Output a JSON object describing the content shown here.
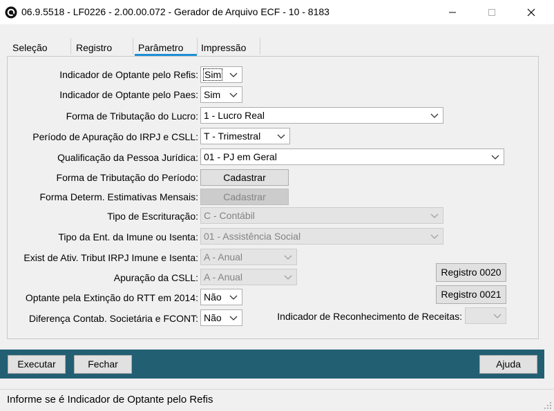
{
  "window": {
    "title": "06.9.5518 - LF0226 - 2.00.00.072 - Gerador de Arquivo ECF - 10 - 8183"
  },
  "tabs": [
    {
      "label": "Seleção"
    },
    {
      "label": "Registro"
    },
    {
      "label": "Parâmetro"
    },
    {
      "label": "Impressão"
    }
  ],
  "form": {
    "refis": {
      "label": "Indicador de Optante pelo Refis:",
      "value": "Sim"
    },
    "paes": {
      "label": "Indicador de Optante pelo Paes:",
      "value": "Sim"
    },
    "tributacao_lucro": {
      "label": "Forma de Tributação do Lucro:",
      "value": "1 - Lucro Real"
    },
    "periodo_apuracao": {
      "label": "Período de Apuração do IRPJ e CSLL:",
      "value": "T - Trimestral"
    },
    "qualificacao": {
      "label": "Qualificação da Pessoa Jurídica:",
      "value": "01 - PJ em Geral"
    },
    "tributacao_periodo": {
      "label": "Forma de Tributação do Período:",
      "button": "Cadastrar"
    },
    "estimativas_mensais": {
      "label": "Forma Determ. Estimativas Mensais:",
      "button": "Cadastrar"
    },
    "tipo_escrituracao": {
      "label": "Tipo de Escrituração:",
      "value": "C - Contábil"
    },
    "tipo_ent_imune": {
      "label": "Tipo da Ent. da Imune ou Isenta:",
      "value": "01 - Assistência Social"
    },
    "exist_ativ": {
      "label": "Exist de Ativ. Tribut IRPJ Imune e Isenta:",
      "value": "A - Anual"
    },
    "apuracao_csll": {
      "label": "Apuração da CSLL:",
      "value": "A - Anual"
    },
    "extincao_rtt": {
      "label": "Optante pela Extinção do RTT em 2014:",
      "value": "Não"
    },
    "diferenca_contab": {
      "label": "Diferença Contab. Societária e FCONT:",
      "value": "Não"
    },
    "reconhecimento_receitas": {
      "label": "Indicador de Reconhecimento de Receitas:",
      "value": ""
    },
    "registro_0020": "Registro 0020",
    "registro_0021": "Registro 0021"
  },
  "actions": {
    "executar": "Executar",
    "fechar": "Fechar",
    "ajuda": "Ajuda"
  },
  "status": {
    "text": "Informe se é  Indicador de Optante pelo Refis"
  },
  "colors": {
    "accent_tab": "#1c8fd6",
    "bottom_bar": "#235f73"
  }
}
